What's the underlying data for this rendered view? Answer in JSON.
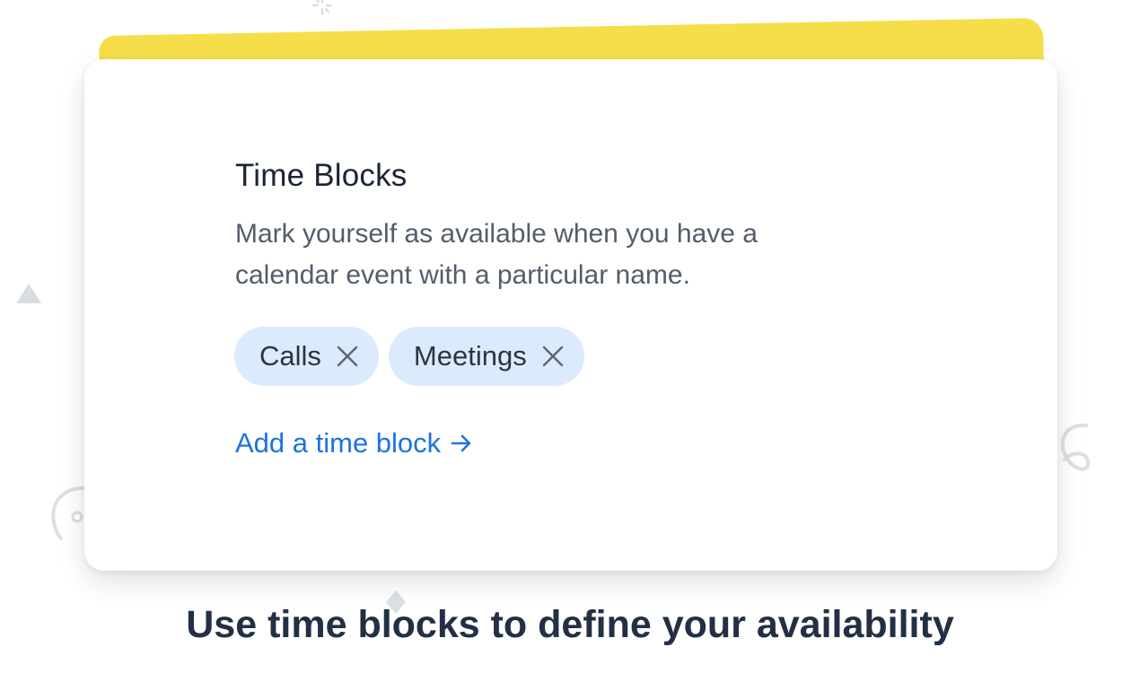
{
  "card": {
    "title": "Time Blocks",
    "description": "Mark yourself as available when you have a calendar event with a particular name.",
    "chips": [
      {
        "label": "Calls",
        "close_icon": "close-icon"
      },
      {
        "label": "Meetings",
        "close_icon": "close-icon"
      }
    ],
    "add_link": {
      "label": "Add a time block",
      "icon": "arrow-right-icon"
    }
  },
  "caption": "Use time blocks to define your availability",
  "colors": {
    "accent_yellow": "#f6de4a",
    "chip_bg": "#dcebfb",
    "link_blue": "#1c74e0",
    "title_dark": "#1b2433",
    "caption_dark": "#232f44"
  }
}
